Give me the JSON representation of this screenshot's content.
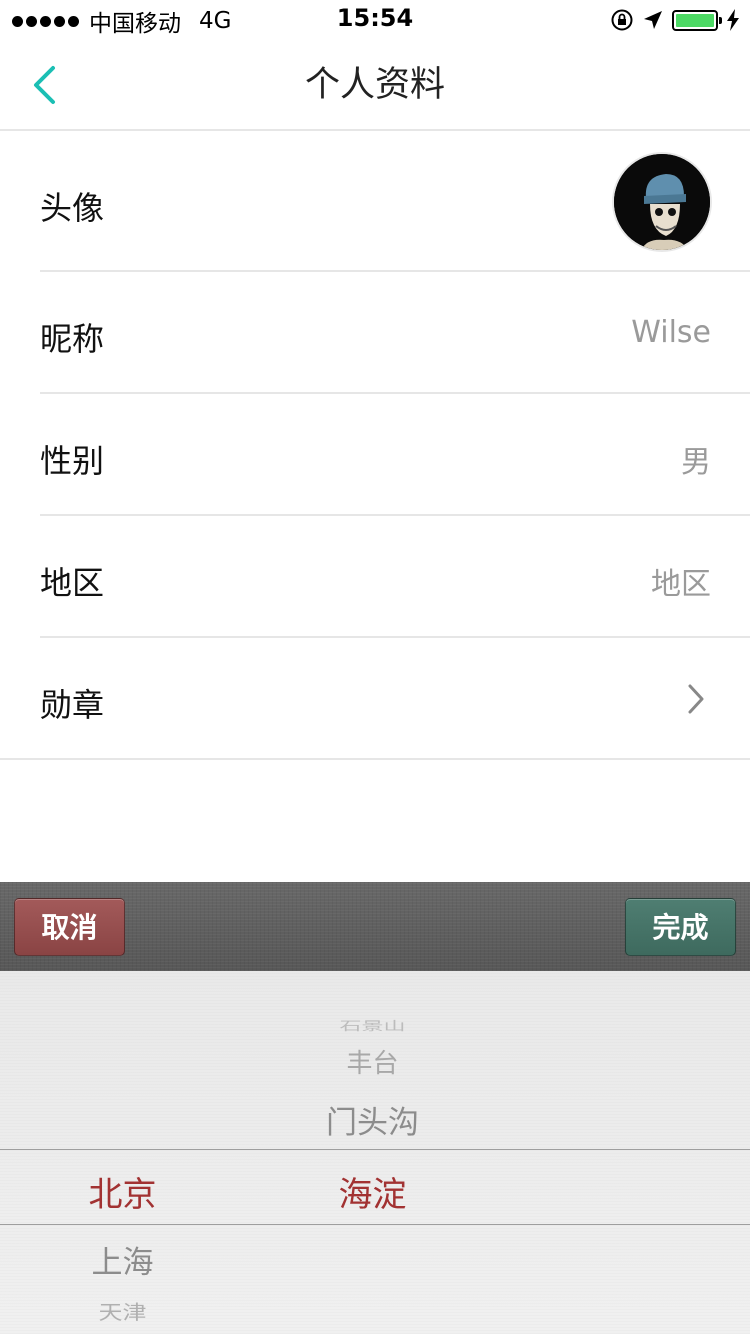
{
  "status_bar": {
    "carrier": "中国移动",
    "network": "4G",
    "time": "15:54",
    "battery_level": 1.0
  },
  "nav": {
    "title": "个人资料",
    "back_icon": "chevron-left-icon",
    "accent_color": "#1bbfb4"
  },
  "profile": {
    "avatar_label": "头像",
    "nickname_label": "昵称",
    "nickname_value": "Wilse",
    "gender_label": "性别",
    "gender_value": "男",
    "region_label": "地区",
    "region_value": "地区",
    "medal_label": "勋章"
  },
  "picker_toolbar": {
    "cancel_label": "取消",
    "done_label": "完成",
    "cancel_color": "#974e4e",
    "done_color": "#467569"
  },
  "picker": {
    "province_column": [
      "北京",
      "上海",
      "天津"
    ],
    "province_selected": "北京",
    "district_column": [
      "石景山",
      "丰台",
      "门头沟",
      "海淀"
    ],
    "district_selected": "海淀",
    "selected_color": "#a23232"
  }
}
